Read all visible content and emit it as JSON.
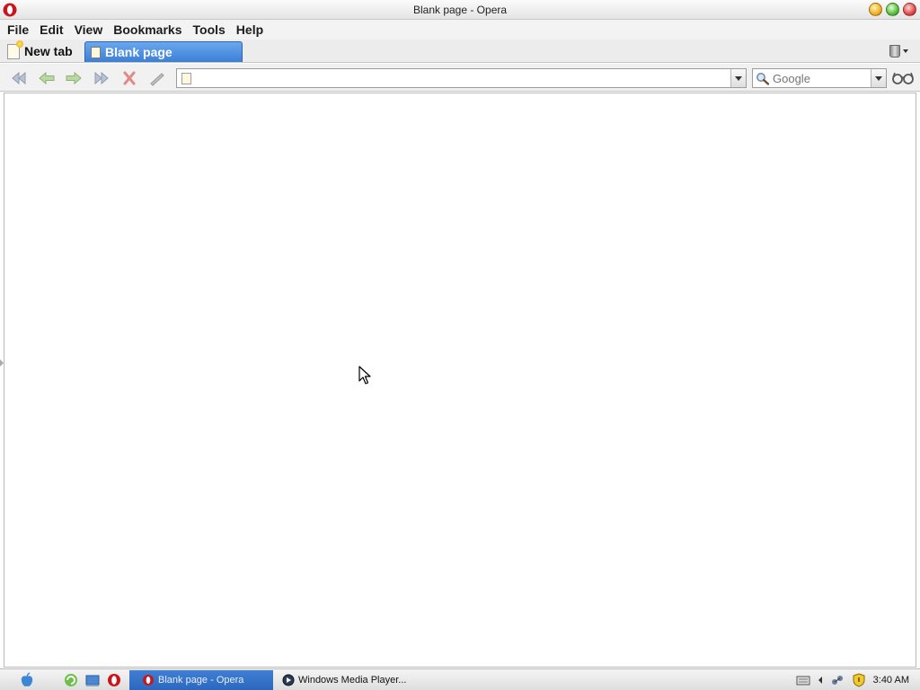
{
  "window": {
    "title": "Blank page - Opera"
  },
  "menu": [
    "File",
    "Edit",
    "View",
    "Bookmarks",
    "Tools",
    "Help"
  ],
  "tabs": {
    "new_tab_label": "New tab",
    "active_tab_label": "Blank page"
  },
  "address": {
    "value": ""
  },
  "search": {
    "placeholder": "Google"
  },
  "taskbar": {
    "tasks": [
      {
        "label": "Blank page - Opera",
        "active": true
      },
      {
        "label": "Windows Media Player...",
        "active": false
      }
    ],
    "clock": "3:40 AM"
  },
  "colors": {
    "accent": "#3b7fd8",
    "titlebar": "#efefef",
    "content_bg": "#ffffff"
  },
  "icons": [
    "opera-icon",
    "back-icon",
    "rewind-icon",
    "forward-icon",
    "fast-forward-icon",
    "stop-icon",
    "edit-icon",
    "search-icon",
    "glasses-icon",
    "trash-icon"
  ]
}
